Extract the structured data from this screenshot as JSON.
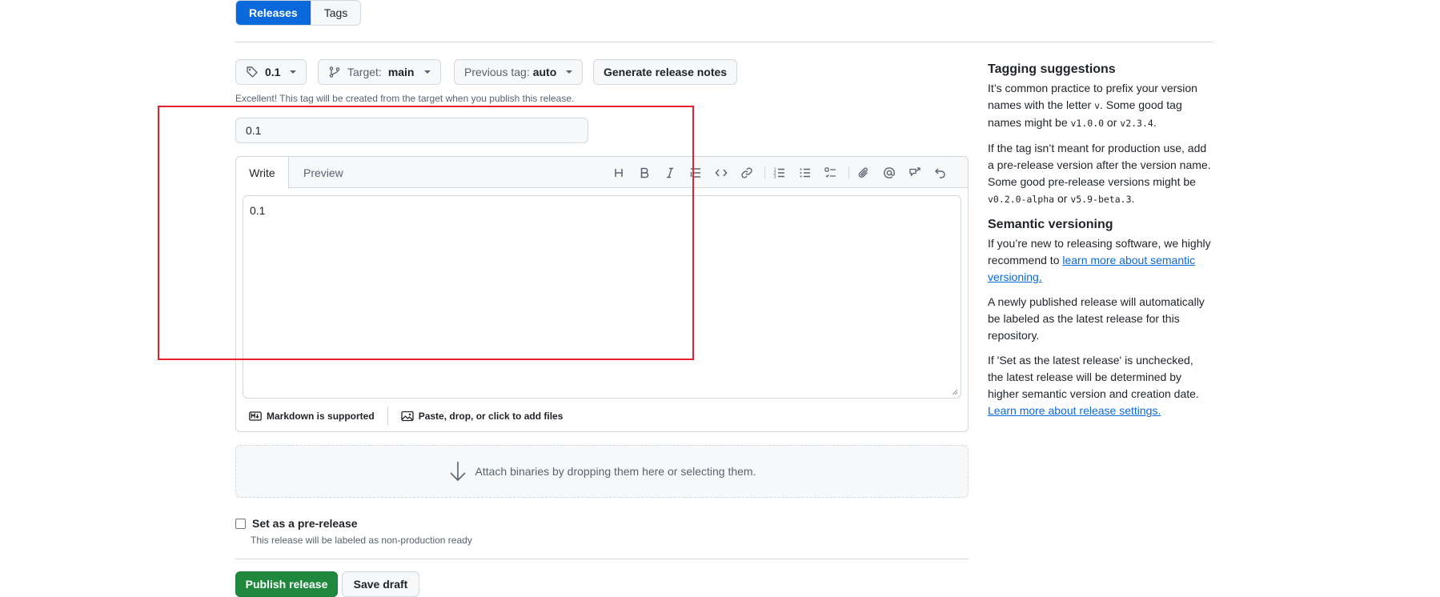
{
  "nav": {
    "releases_label": "Releases",
    "tags_label": "Tags"
  },
  "controls": {
    "tag_value": "0.1",
    "target_label": "Target:",
    "target_value": "main",
    "previous_tag_label": "Previous tag:",
    "previous_tag_value": "auto",
    "generate_label": "Generate release notes",
    "hint": "Excellent! This tag will be created from the target when you publish this release."
  },
  "title_input": {
    "value": "0.1"
  },
  "editor": {
    "write_tab": "Write",
    "preview_tab": "Preview",
    "body": "0.1",
    "markdown_note": "Markdown is supported",
    "attach_note": "Paste, drop, or click to add files"
  },
  "attach": {
    "label": "Attach binaries by dropping them here or selecting them."
  },
  "prerelease": {
    "label": "Set as a pre-release",
    "sub": "This release will be labeled as non-production ready"
  },
  "actions": {
    "publish": "Publish release",
    "draft": "Save draft"
  },
  "sidebar": {
    "tag_heading": "Tagging suggestions",
    "tag_p1_a": "It’s common practice to prefix your version names with the letter ",
    "tag_p1_code1": "v",
    "tag_p1_b": ". Some good tag names might be ",
    "tag_p1_code2": "v1.0.0",
    "tag_p1_c": " or ",
    "tag_p1_code3": "v2.3.4",
    "tag_p1_d": ".",
    "tag_p2_a": "If the tag isn’t meant for production use, add a pre-release version after the version name. Some good pre-release versions might be ",
    "tag_p2_code1": "v0.2.0-alpha",
    "tag_p2_b": " or ",
    "tag_p2_code2": "v5.9-beta.3",
    "tag_p2_c": ".",
    "sem_heading": "Semantic versioning",
    "sem_p1_a": "If you’re new to releasing software, we highly recommend to ",
    "sem_p1_link": "learn more about semantic versioning.",
    "sem_p2": "A newly published release will automatically be labeled as the latest release for this repository.",
    "sem_p3_a": "If 'Set as the latest release' is unchecked, the latest release will be determined by higher semantic version and creation date. ",
    "sem_p3_link": "Learn more about release settings."
  },
  "colors": {
    "primary": "#0969da",
    "success": "#1f883d",
    "highlight": "#e5202e",
    "border": "#d1d9e0"
  }
}
